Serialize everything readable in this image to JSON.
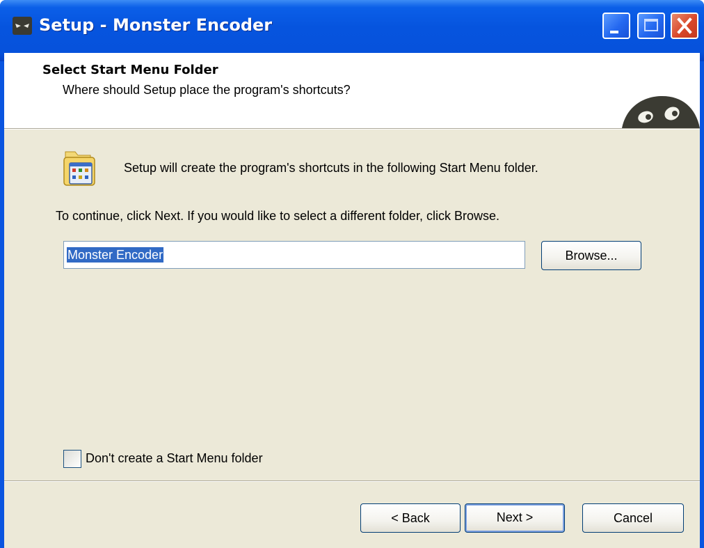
{
  "window": {
    "title": "Setup - Monster Encoder",
    "controls": {
      "minimize": "minimize-icon",
      "maximize": "maximize-icon",
      "close": "close-icon"
    }
  },
  "header": {
    "title": "Select Start Menu Folder",
    "subtitle": "Where should Setup place the program's shortcuts?",
    "logo": "monster-eyes-icon"
  },
  "body": {
    "intro": "Setup will create the program's shortcuts in the following Start Menu folder.",
    "instructions": "To continue, click Next. If you would like to select a different folder, click Browse.",
    "folder_value": "Monster Encoder",
    "browse_label": "Browse...",
    "no_folder_checkbox": {
      "label": "Don't create a Start Menu folder",
      "checked": false
    }
  },
  "footer": {
    "back_label": "< Back",
    "next_label": "Next >",
    "cancel_label": "Cancel"
  },
  "colors": {
    "titlebar": "#0654de",
    "close_button": "#d9482a",
    "dialog_bg": "#ece9d8",
    "selection": "#316ac5"
  }
}
